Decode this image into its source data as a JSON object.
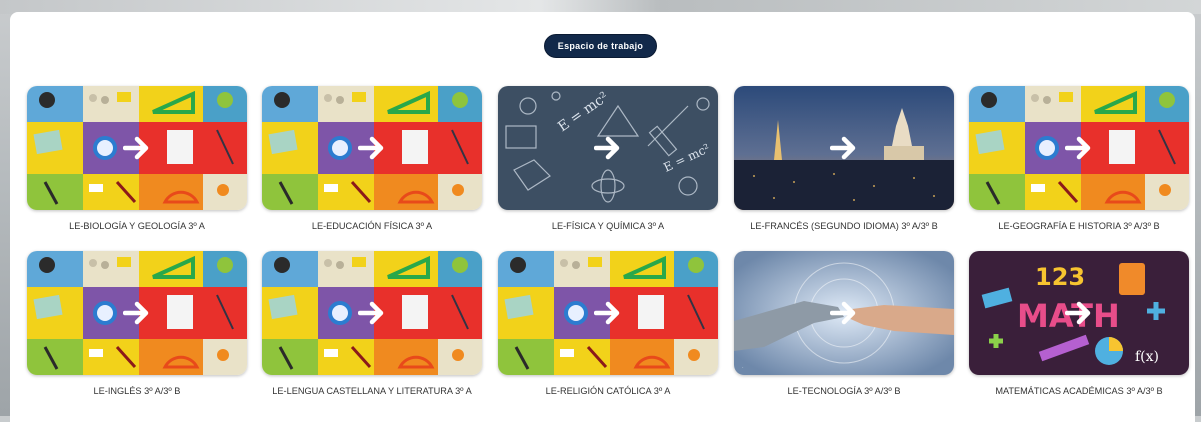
{
  "header": {
    "workspace_label": "Espacio de trabajo"
  },
  "courses": [
    {
      "name": "LE-BIOLOGÍA Y GEOLOGÍA 3º A",
      "image": "school-supplies"
    },
    {
      "name": "LE-EDUCACIÓN FÍSICA 3º A",
      "image": "school-supplies"
    },
    {
      "name": "LE-FÍSICA Y QUÍMICA 3º A",
      "image": "physics-chalkboard"
    },
    {
      "name": "LE-FRANCÉS (SEGUNDO IDIOMA) 3º A/3º B",
      "image": "paris-night"
    },
    {
      "name": "LE-GEOGRAFÍA E HISTORIA 3º A/3º B",
      "image": "school-supplies"
    },
    {
      "name": "LE-INGLÉS 3º A/3º B",
      "image": "school-supplies"
    },
    {
      "name": "LE-LENGUA CASTELLANA Y LITERATURA 3º A",
      "image": "school-supplies"
    },
    {
      "name": "LE-RELIGIÓN CATÓLICA 3º A",
      "image": "school-supplies"
    },
    {
      "name": "LE-TECNOLOGÍA 3º A/3º B",
      "image": "robot-human-hands"
    },
    {
      "name": "MATEMÁTICAS ACADÉMICAS 3º A/3º B",
      "image": "math-symbols"
    }
  ],
  "colors": {
    "pill_bg": "#12294a",
    "supplies_cells": [
      "#f2d21a",
      "#3c86c6",
      "#7e55a8",
      "#e8302b",
      "#8fc43c",
      "#f08a1f"
    ],
    "chalkboard": "#3d4f63",
    "paris_sky": "#2c4a7a",
    "math_bg": "#3a1f3a"
  }
}
